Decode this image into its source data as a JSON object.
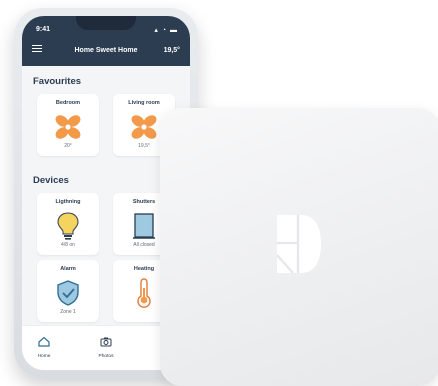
{
  "status_bar": {
    "time": "9:41",
    "icons": "▴ ◔ ▬"
  },
  "header": {
    "title": "Home Sweet Home",
    "temperature": "19,5°"
  },
  "favourites": {
    "title": "Favourites",
    "items": [
      {
        "label": "Bedroom",
        "value": "20°",
        "icon": "fan-icon"
      },
      {
        "label": "Living room",
        "value": "19,5°",
        "icon": "fan-icon"
      }
    ]
  },
  "devices": {
    "title": "Devices",
    "items": [
      {
        "label": "Ligthning",
        "value": "4/8 on",
        "icon": "lightbulb-icon"
      },
      {
        "label": "Shutters",
        "value": "All closed",
        "icon": "shutter-icon"
      },
      {
        "label": "Alarm",
        "value": "Zone 1",
        "icon": "shield-check-icon"
      },
      {
        "label": "Heating",
        "value": "",
        "icon": "thermometer-icon"
      }
    ]
  },
  "bottom_nav": {
    "items": [
      {
        "label": "Home",
        "icon": "home-icon"
      },
      {
        "label": "Photos",
        "icon": "camera-icon"
      },
      {
        "label": "Routi",
        "icon": "routine-icon"
      }
    ]
  },
  "colors": {
    "header_bg": "#2c3d52",
    "accent_orange": "#f2994a",
    "icon_blue": "#2f6f95",
    "bulb_yellow": "#f4d35e"
  }
}
